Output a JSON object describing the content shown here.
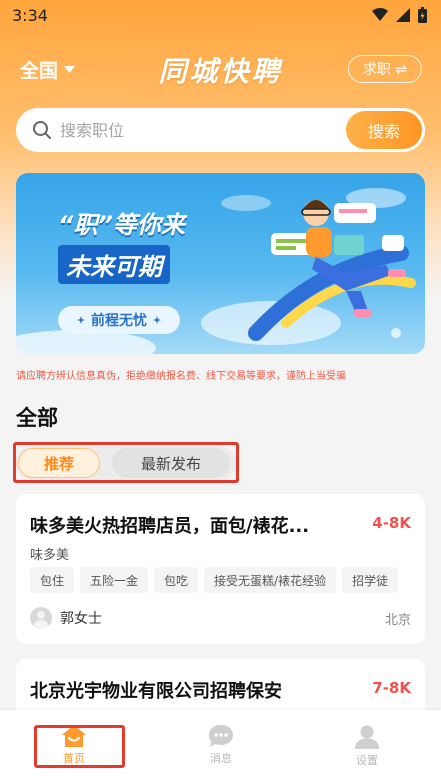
{
  "status_bar": {
    "time": "3:34",
    "icons": [
      "wifi-icon",
      "signal-icon",
      "battery-icon"
    ]
  },
  "header": {
    "region": "全国",
    "title": "同城快聘",
    "role_switch": "求职 ⇌"
  },
  "search": {
    "placeholder": "搜索职位",
    "button": "搜索"
  },
  "banner": {
    "line1": "“职”等你来",
    "line2": "未来可期",
    "pill": "前程无忧"
  },
  "notice": "请应聘方辨认信息真伪，拒绝缴纳报名费、线下交易等要求，谨防上当受骗",
  "section": {
    "title": "全部",
    "tabs": [
      "推荐",
      "最新发布"
    ]
  },
  "jobs": [
    {
      "title": "味多美火热招聘店员，面包/裱花...",
      "salary": "4-8K",
      "company": "味多美",
      "tags": [
        "包住",
        "五险一金",
        "包吃",
        "接受无蛋糕/裱花经验",
        "招学徒"
      ],
      "poster": "郭女士",
      "city": "北京"
    },
    {
      "title": "北京光宇物业有限公司招聘保安",
      "salary": "7-8K"
    }
  ],
  "tabbar": {
    "items": [
      "首页",
      "消息",
      "设置"
    ]
  },
  "colors": {
    "accent": "#ff9a2e",
    "salary": "#f2524b",
    "highlight": "#e23b2e"
  }
}
